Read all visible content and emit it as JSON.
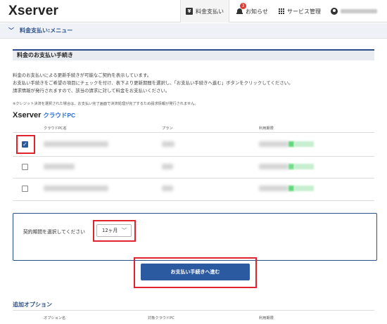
{
  "header": {
    "logo": "Xserver",
    "tabs": {
      "payment": "料金支払い",
      "notice": "お知らせ",
      "notice_badge": "3",
      "service": "サービス管理"
    }
  },
  "subheader": {
    "title": "料金支払い:メニュー"
  },
  "section": {
    "title": "料金のお支払い手続き",
    "desc_lines": [
      "料金のお支払いによる更新手続きが可能なご契約を表示しています。",
      "お支払い手続きをご希望の項目にチェックを付け、表下より更新期間を選択し、「お支払い手続きへ進む」ボタンをクリックしてください。",
      "請求情報が発行されますので、該当の請求に対して料金をお支払いください。"
    ],
    "note": "※クレジット決済を選択された場合は、お支払い完了画面で決済処理が完了するため請求情報が発行されません。"
  },
  "product": {
    "logo_main": "Xserver",
    "logo_sub": "クラウドPC",
    "columns": [
      "クラウドPC名",
      "プラン",
      "利用期限"
    ],
    "rows": [
      {
        "checked": true
      },
      {
        "checked": false
      },
      {
        "checked": false
      }
    ]
  },
  "period": {
    "label": "契約期間を選択してください",
    "selected": "12ヶ月"
  },
  "proceed_button": "お支払い手続きへ進む",
  "options": {
    "title": "追加オプション",
    "columns": [
      "オプション名",
      "対象クラウドPC",
      "利用期限"
    ]
  }
}
